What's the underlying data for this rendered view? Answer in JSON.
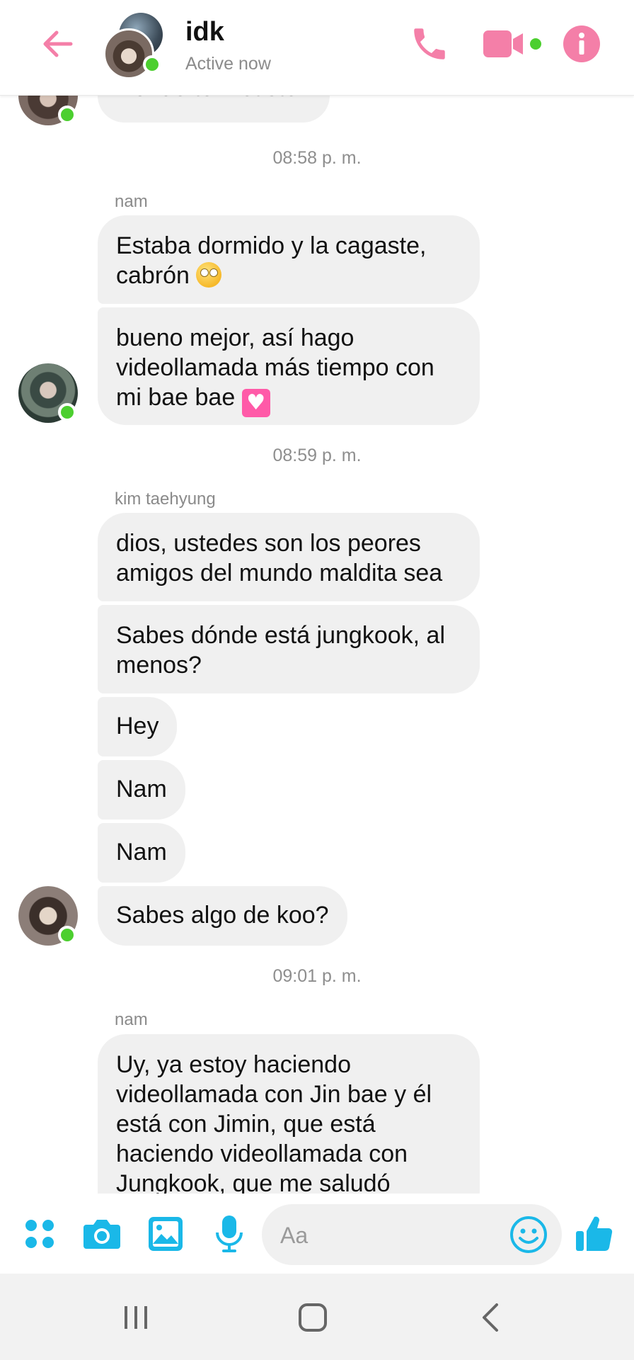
{
  "header": {
    "title": "idk",
    "status": "Active now",
    "colors": {
      "accent": "#f47fa8",
      "online": "#4ccf2f"
    },
    "icons": [
      "back-arrow-icon",
      "phone-icon",
      "video-call-icon",
      "info-icon"
    ]
  },
  "chat": {
    "partial_message": "Donde te metiste?",
    "groups": [
      {
        "time": "08:58 p. m.",
        "sender": "nam",
        "messages": [
          "Estaba dormido y la cagaste, cabrón",
          "bueno mejor, así hago videollamada más tiempo con mi bae bae"
        ]
      },
      {
        "time": "08:59 p. m.",
        "sender": "kim taehyung",
        "messages": [
          "dios, ustedes son los peores amigos del mundo maldita sea",
          "Sabes dónde está jungkook, al menos?",
          "Hey",
          "Nam",
          "Nam",
          "Sabes algo de koo?"
        ]
      },
      {
        "time": "09:01 p. m.",
        "sender": "nam",
        "messages": [
          "Uy, ya estoy haciendo videollamada con Jin bae y él está con Jimin, que está haciendo videollamada con Jungkook, que me saludó"
        ]
      }
    ],
    "bubble_color": "#f0f0f0"
  },
  "composer": {
    "placeholder": "Aa",
    "accent": "#1ab8e8",
    "icons": [
      "apps-icon",
      "camera-icon",
      "image-icon",
      "microphone-icon",
      "emoji-icon",
      "thumbs-up-icon"
    ]
  },
  "system_nav": {
    "icons": [
      "recent-apps-icon",
      "home-icon",
      "back-icon"
    ]
  }
}
